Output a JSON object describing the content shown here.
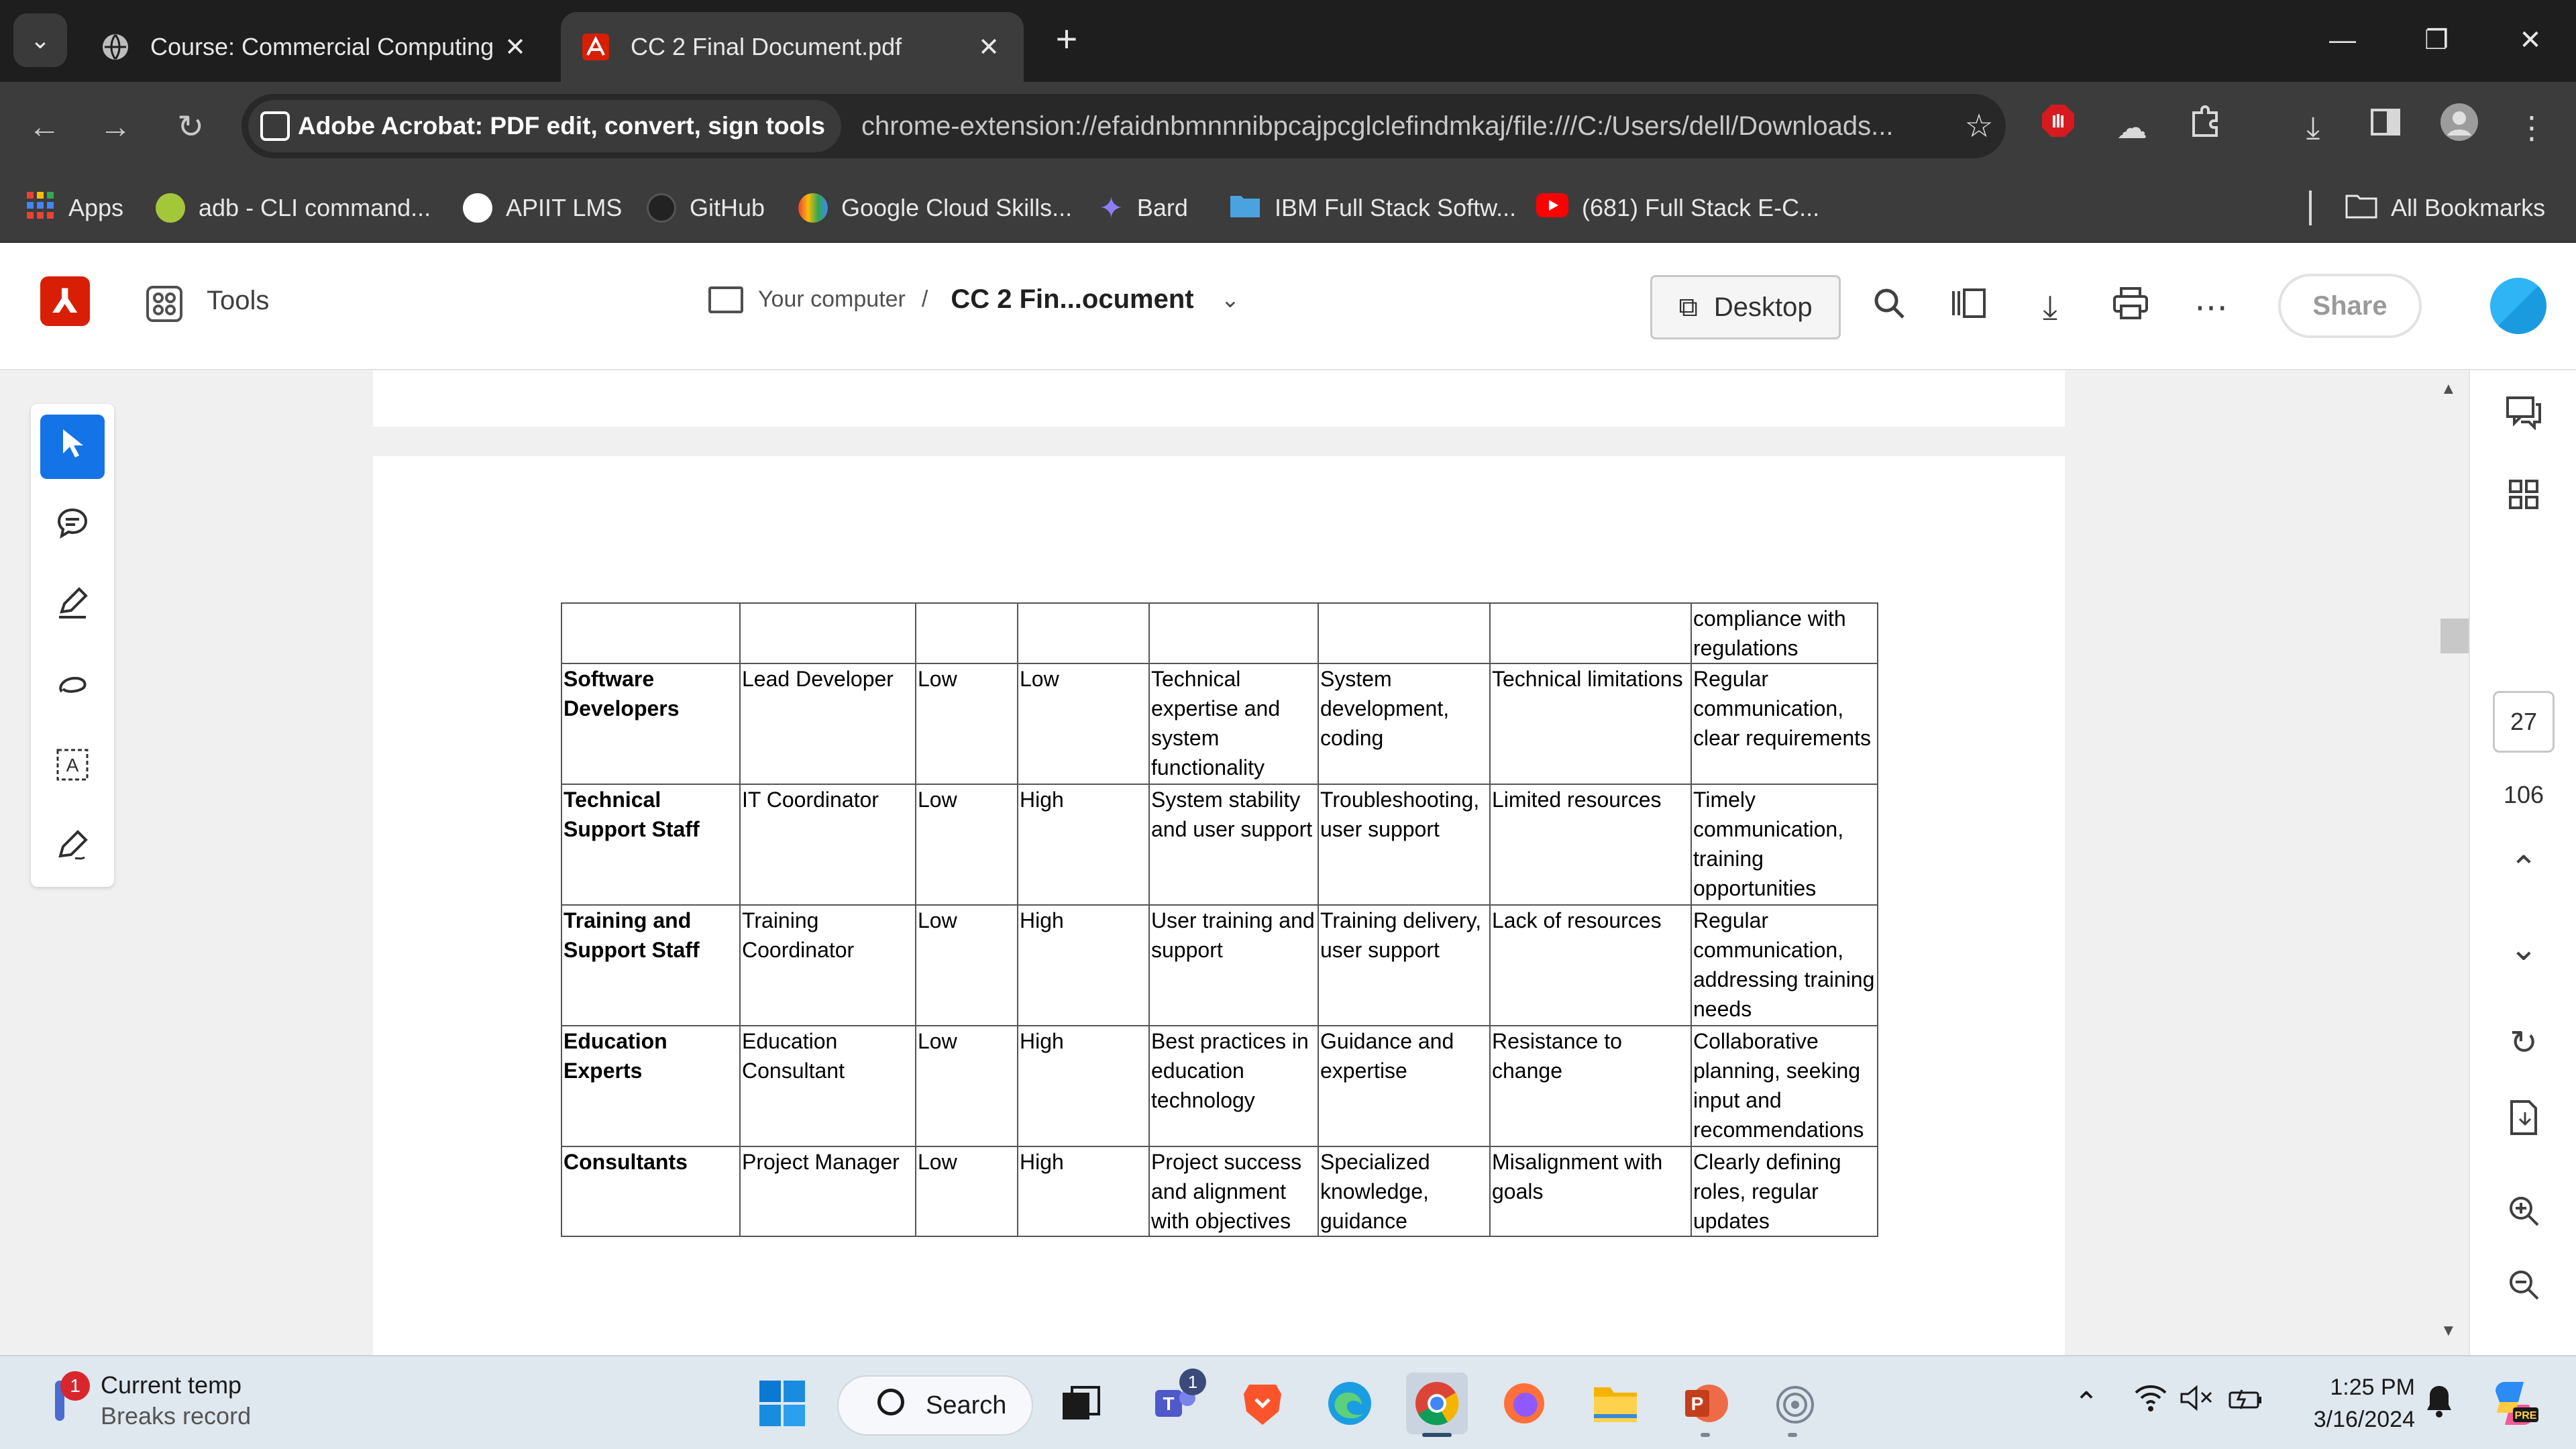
{
  "tabs": [
    {
      "title": "Course: Commercial Computing",
      "close": "✕"
    },
    {
      "title": "CC 2 Final Document.pdf",
      "close": "✕"
    }
  ],
  "new_tab": "+",
  "window_controls": {
    "minimize": "—",
    "restore": "❐",
    "close": "✕"
  },
  "omnibox": {
    "extension_chip": "Adobe Acrobat: PDF edit, convert, sign tools",
    "url": "chrome-extension://efaidnbmnnnibpcajpcglclefindmkaj/file:///C:/Users/dell/Downloads..."
  },
  "bookmarks": [
    {
      "label": "Apps",
      "icon": "apps-grid-icon",
      "color": "#e94235"
    },
    {
      "label": "adb - CLI command...",
      "icon": "android-icon",
      "color": "#a4c639"
    },
    {
      "label": "APIIT LMS",
      "icon": "globe-icon",
      "color": "#ffffff"
    },
    {
      "label": "GitHub",
      "icon": "github-icon",
      "color": "#222222"
    },
    {
      "label": "Google Cloud Skills...",
      "icon": "google-cloud-icon",
      "color": "#4285f4"
    },
    {
      "label": "Bard",
      "icon": "bard-sparkle-icon",
      "color": "#8e7cf5"
    },
    {
      "label": "IBM Full Stack Softw...",
      "icon": "folder-icon",
      "color": "#4aa3df"
    },
    {
      "label": "(681) Full Stack E-C...",
      "icon": "youtube-icon",
      "color": "#ff0000"
    },
    {
      "label": "All Bookmarks",
      "icon": "folder-outline-icon",
      "color": "#ffffff"
    }
  ],
  "acrobat": {
    "tools_label": "Tools",
    "breadcrumb_location": "Your computer",
    "breadcrumb_sep": "/",
    "document_name": "CC 2 Fin...ocument",
    "desktop_button": "Desktop",
    "share_button": "Share",
    "accent_color": "#1473e6",
    "brand_color": "#d81e05"
  },
  "page_nav": {
    "current": "27",
    "total": "106"
  },
  "table": {
    "rows": [
      {
        "cells": [
          "",
          "",
          "",
          "",
          "",
          "",
          "",
          "compliance with regulations"
        ]
      },
      {
        "cells": [
          "Software Developers",
          "Lead Developer",
          "Low",
          "Low",
          "Technical expertise and system functionality",
          "System development, coding",
          "Technical limitations",
          "Regular communication, clear requirements"
        ]
      },
      {
        "cells": [
          "Technical Support Staff",
          "IT Coordinator",
          "Low",
          "High",
          "System stability and user support",
          "Troubleshooting, user support",
          "Limited resources",
          "Timely communication, training opportunities"
        ]
      },
      {
        "cells": [
          "Training and Support Staff",
          "Training Coordinator",
          "Low",
          "High",
          "User training and support",
          "Training delivery, user support",
          "Lack of resources",
          "Regular communication, addressing training needs"
        ]
      },
      {
        "cells": [
          "Education Experts",
          "Education Consultant",
          "Low",
          "High",
          "Best practices in education technology",
          "Guidance and expertise",
          "Resistance to change",
          "Collaborative planning, seeking input and recommendations"
        ]
      },
      {
        "cells": [
          "Consultants",
          "Project Manager",
          "Low",
          "High",
          "Project success and alignment with objectives",
          "Specialized knowledge, guidance",
          "Misalignment with goals",
          "Clearly defining roles, regular updates"
        ]
      }
    ]
  },
  "taskbar": {
    "weather_title": "Current temp",
    "weather_sub": "Breaks record",
    "weather_badge": "1",
    "search_label": "Search",
    "teams_badge": "1",
    "time": "1:25 PM",
    "date": "3/16/2024"
  }
}
